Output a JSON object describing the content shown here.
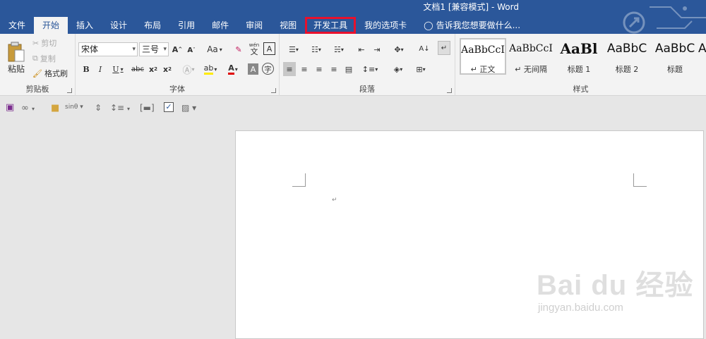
{
  "window": {
    "title": "文档1 [兼容模式] - Word"
  },
  "tabs": [
    {
      "label": "文件"
    },
    {
      "label": "开始"
    },
    {
      "label": "插入"
    },
    {
      "label": "设计"
    },
    {
      "label": "布局"
    },
    {
      "label": "引用"
    },
    {
      "label": "邮件"
    },
    {
      "label": "审阅"
    },
    {
      "label": "视图"
    },
    {
      "label": "开发工具"
    },
    {
      "label": "我的选项卡"
    }
  ],
  "tell_me": "告诉我您想要做什么...",
  "clipboard": {
    "label": "剪贴板",
    "paste": "粘贴",
    "cut": "剪切",
    "copy": "复制",
    "format_painter": "格式刷"
  },
  "font": {
    "label": "字体",
    "name": "宋体",
    "size": "三号",
    "aa": "Aa",
    "wen": "wén",
    "wen_char": "文",
    "a_char": "A",
    "zi": "字"
  },
  "paragraph": {
    "label": "段落"
  },
  "styles": {
    "label": "样式",
    "items": [
      {
        "preview": "AaBbCcI",
        "name": "↵ 正文"
      },
      {
        "preview": "AaBbCcI",
        "name": "↵ 无间隔"
      },
      {
        "preview": "AaBl",
        "name": "标题 1"
      },
      {
        "preview": "AaBbC",
        "name": "标题 2"
      },
      {
        "preview": "AaBbC",
        "name": "标题"
      },
      {
        "preview": "A",
        "name": ""
      }
    ]
  },
  "qat": {
    "infinity": "∞",
    "sin": "sinθ"
  },
  "document": {
    "para_mark": "↵"
  },
  "watermark": {
    "main": "Bai du 经验",
    "sub": "jingyan.baidu.com"
  },
  "colors": {
    "brand": "#2b579a",
    "highlight_box": "#e8112d"
  }
}
